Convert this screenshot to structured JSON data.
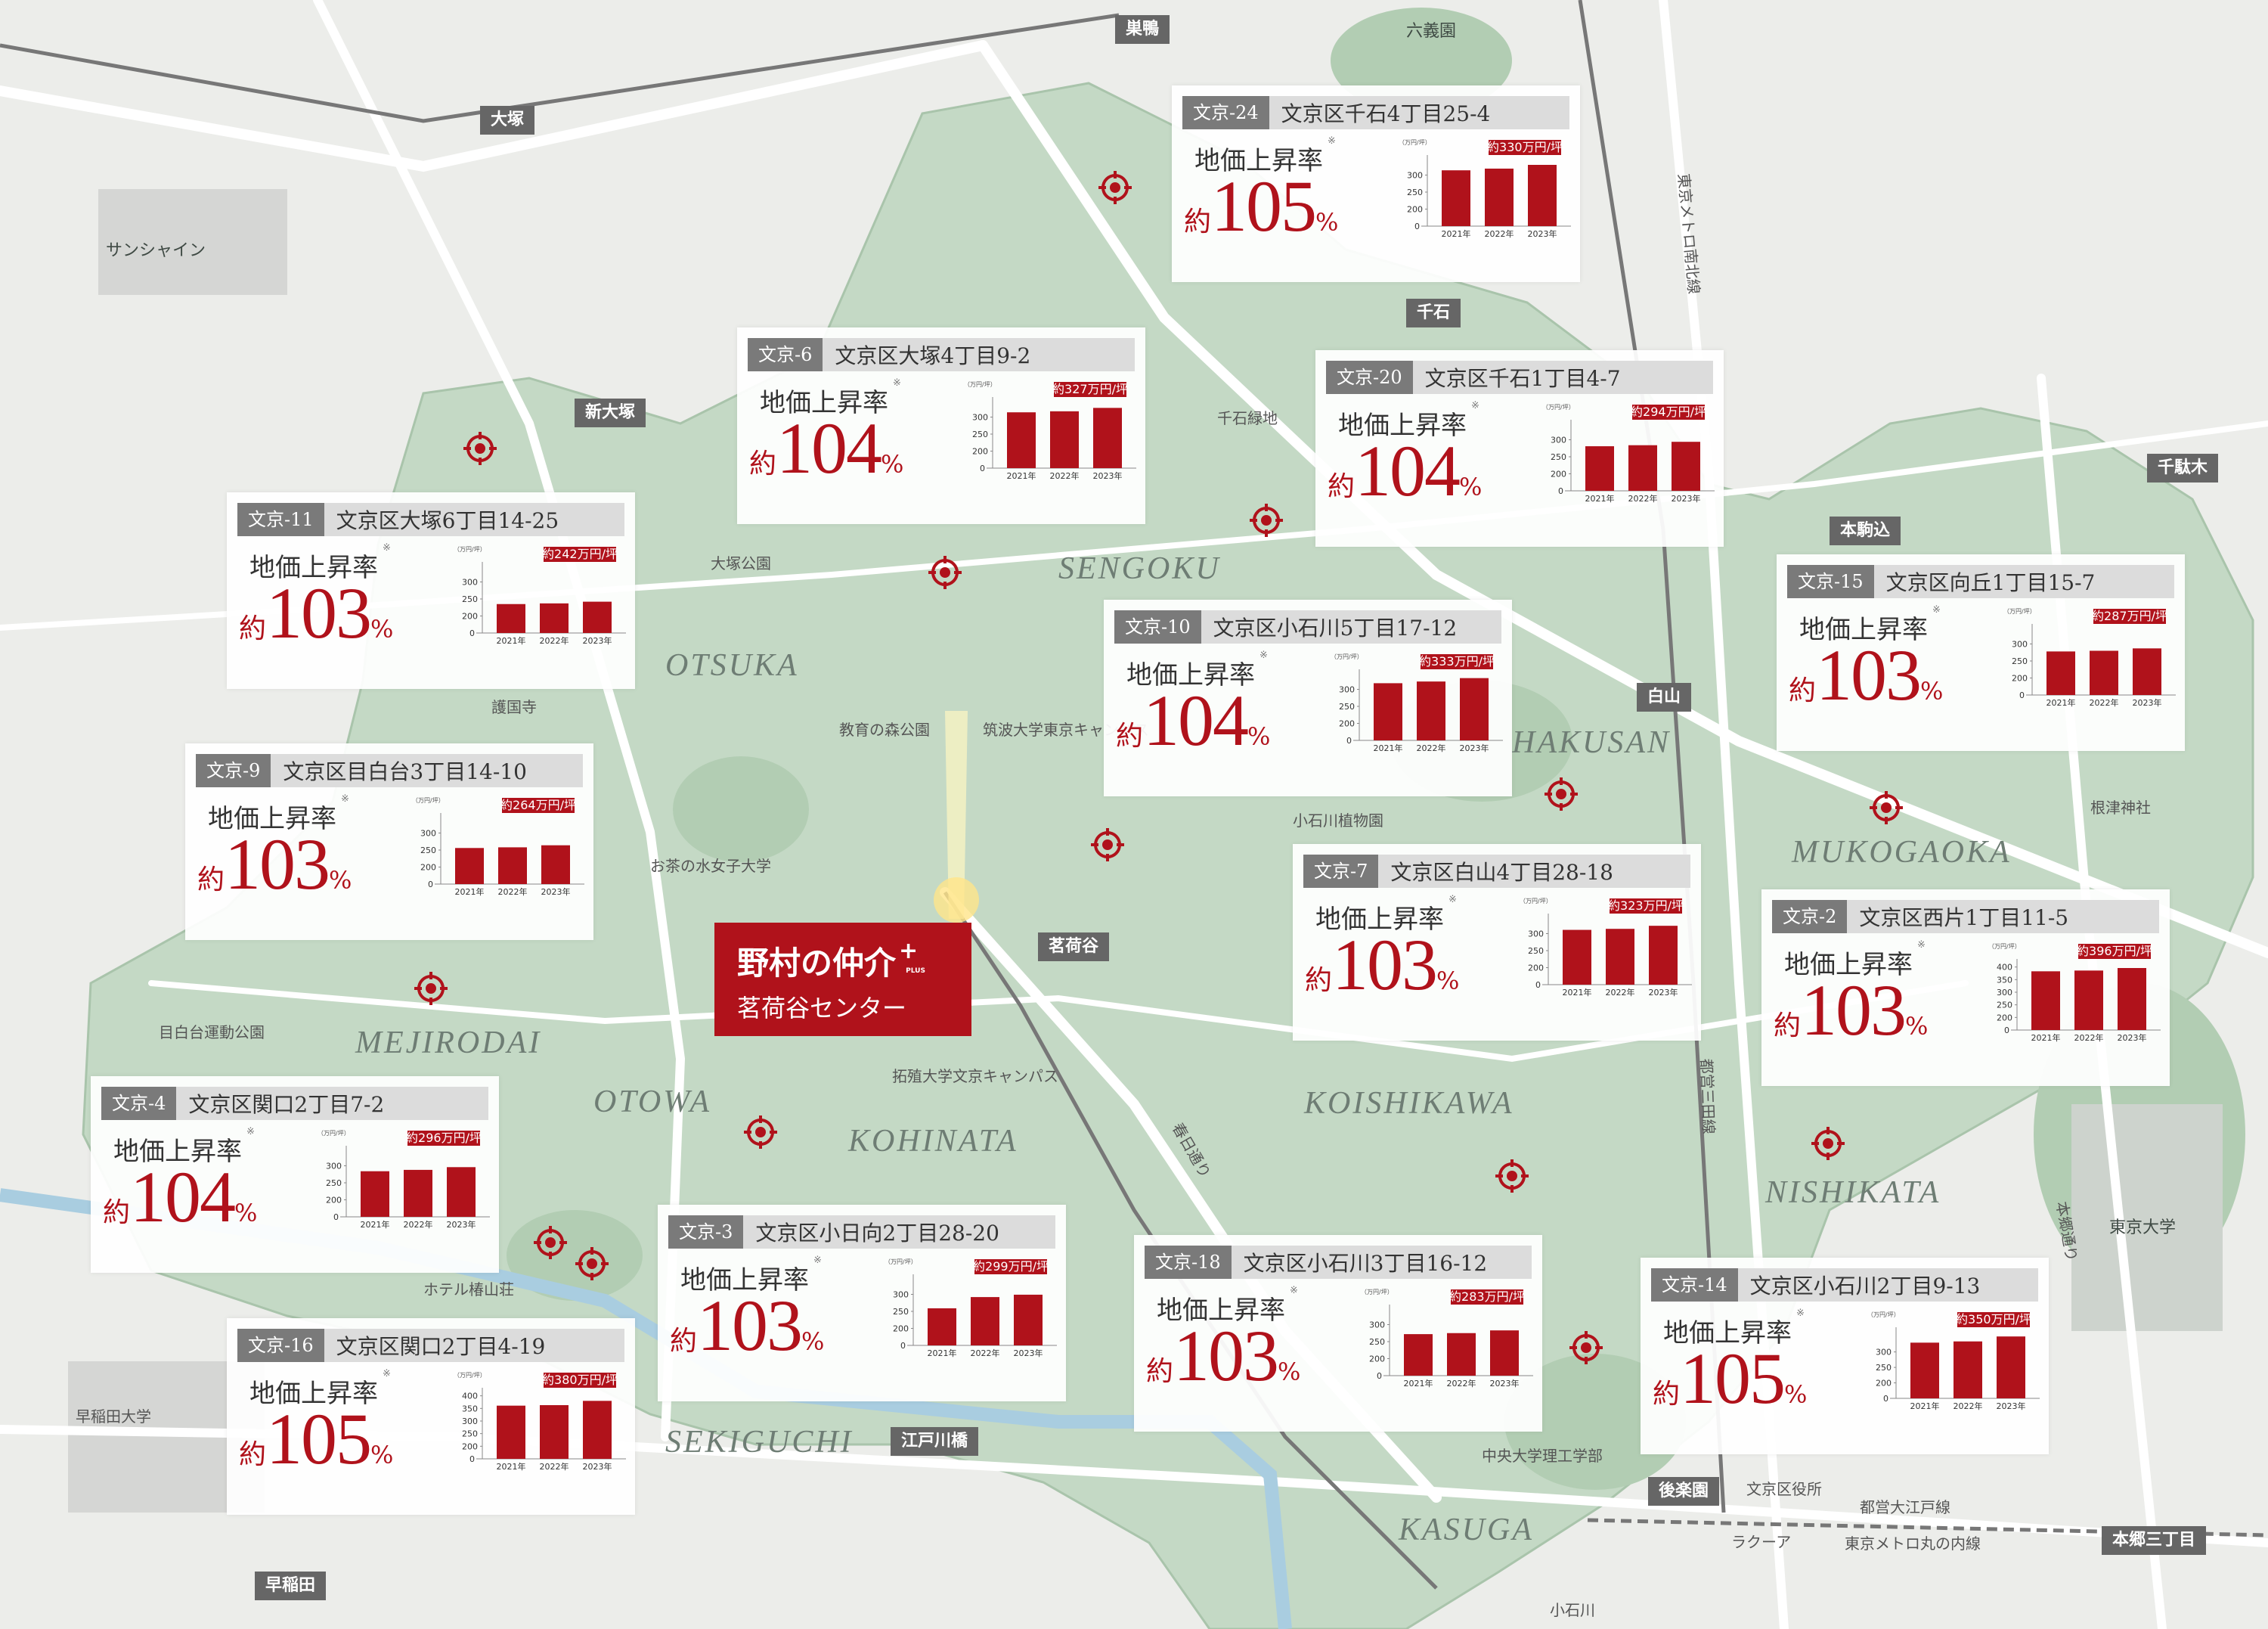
{
  "colors": {
    "accent": "#b0121b",
    "park": "#cfe0cf",
    "bunkyo_area": "#b8d2ba",
    "road": "#ffffff",
    "map_bg": "#ecedea"
  },
  "center": {
    "brand": "野村の仲介",
    "brand_mark": "+",
    "brand_sub": "PLUS",
    "name": "茗荷谷センター"
  },
  "stations": [
    {
      "id": "sugamo",
      "label": "巣鴨"
    },
    {
      "id": "otsuka",
      "label": "大塚"
    },
    {
      "id": "sengoku",
      "label": "千石"
    },
    {
      "id": "shin-otsuka",
      "label": "新大塚"
    },
    {
      "id": "sendagi",
      "label": "千駄木"
    },
    {
      "id": "hon-komagome",
      "label": "本駒込"
    },
    {
      "id": "hakusan",
      "label": "白山"
    },
    {
      "id": "myogadani",
      "label": "茗荷谷"
    },
    {
      "id": "edogawabashi",
      "label": "江戸川橋"
    },
    {
      "id": "korakuen",
      "label": "後楽園"
    },
    {
      "id": "hongo-sanchome",
      "label": "本郷三丁目"
    },
    {
      "id": "waseda",
      "label": "早稲田"
    }
  ],
  "areas": [
    "OTSUKA",
    "SENGOKU",
    "HAKUSAN",
    "MUKOGAOKA",
    "MEJIRODAI",
    "OTOWA",
    "KOHINATA",
    "KOISHIKAWA",
    "NISHIKATA",
    "SEKIGUCHI",
    "KASUGA"
  ],
  "places": [
    "六義園",
    "サンシャイン",
    "大塚公園",
    "千石緑地",
    "護国寺",
    "教育の森公園",
    "筑波大学東京キャンパス",
    "お茶の水女子大学",
    "小石川植物園",
    "根津神社",
    "目白台運動公園",
    "拓殖大学文京キャンパス",
    "ホテル椿山荘",
    "早稲田大学",
    "中央大学理工学部",
    "文京区役所",
    "ラクーア",
    "東京大学",
    "小石川",
    "春日通り",
    "本郷通り",
    "東京メトロ南北線",
    "都営三田線",
    "都営大江戸線",
    "東京メトロ丸の内線"
  ],
  "labels": {
    "rate": "地価上昇率",
    "note_mark": "※",
    "approx": "約",
    "percent": "%",
    "unit": "（万円/坪）",
    "price_prefix": "約",
    "price_suffix": "万円/坪"
  },
  "cards": [
    {
      "code": "文京-24",
      "address": "文京区千石4丁目25-4",
      "rate": "105",
      "price": "330",
      "yticks": [
        "300",
        "250",
        "200"
      ],
      "years": [
        "2021年",
        "2022年",
        "2023年"
      ],
      "chart_data": {
        "type": "bar",
        "categories": [
          "2021年",
          "2022年",
          "2023年"
        ],
        "values": [
          314,
          319,
          330
        ],
        "ylim": [
          150,
          350
        ]
      }
    },
    {
      "code": "文京-6",
      "address": "文京区大塚4丁目9-2",
      "rate": "104",
      "price": "327",
      "yticks": [
        "300",
        "250",
        "200"
      ],
      "years": [
        "2021年",
        "2022年",
        "2023年"
      ],
      "chart_data": {
        "type": "bar",
        "categories": [
          "2021年",
          "2022年",
          "2023年"
        ],
        "values": [
          314,
          317,
          327
        ],
        "ylim": [
          150,
          350
        ]
      }
    },
    {
      "code": "文京-20",
      "address": "文京区千石1丁目4-7",
      "rate": "104",
      "price": "294",
      "yticks": [
        "300",
        "250",
        "200"
      ],
      "years": [
        "2021年",
        "2022年",
        "2023年"
      ],
      "chart_data": {
        "type": "bar",
        "categories": [
          "2021年",
          "2022年",
          "2023年"
        ],
        "values": [
          281,
          284,
          294
        ],
        "ylim": [
          150,
          350
        ]
      }
    },
    {
      "code": "文京-11",
      "address": "文京区大塚6丁目14-25",
      "rate": "103",
      "price": "242",
      "yticks": [
        "300",
        "250",
        "200"
      ],
      "years": [
        "2021年",
        "2022年",
        "2023年"
      ],
      "chart_data": {
        "type": "bar",
        "categories": [
          "2021年",
          "2022年",
          "2023年"
        ],
        "values": [
          235,
          237,
          242
        ],
        "ylim": [
          150,
          350
        ]
      }
    },
    {
      "code": "文京-10",
      "address": "文京区小石川5丁目17-12",
      "rate": "104",
      "price": "333",
      "yticks": [
        "300",
        "250",
        "200"
      ],
      "years": [
        "2021年",
        "2022年",
        "2023年"
      ],
      "chart_data": {
        "type": "bar",
        "categories": [
          "2021年",
          "2022年",
          "2023年"
        ],
        "values": [
          318,
          323,
          333
        ],
        "ylim": [
          150,
          350
        ]
      }
    },
    {
      "code": "文京-15",
      "address": "文京区向丘1丁目15-7",
      "rate": "103",
      "price": "287",
      "yticks": [
        "300",
        "250",
        "200"
      ],
      "years": [
        "2021年",
        "2022年",
        "2023年"
      ],
      "chart_data": {
        "type": "bar",
        "categories": [
          "2021年",
          "2022年",
          "2023年"
        ],
        "values": [
          278,
          280,
          287
        ],
        "ylim": [
          150,
          350
        ]
      }
    },
    {
      "code": "文京-9",
      "address": "文京区目白台3丁目14-10",
      "rate": "103",
      "price": "264",
      "yticks": [
        "300",
        "250",
        "200"
      ],
      "years": [
        "2021年",
        "2022年",
        "2023年"
      ],
      "chart_data": {
        "type": "bar",
        "categories": [
          "2021年",
          "2022年",
          "2023年"
        ],
        "values": [
          256,
          258,
          264
        ],
        "ylim": [
          150,
          350
        ]
      }
    },
    {
      "code": "文京-7",
      "address": "文京区白山4丁目28-18",
      "rate": "103",
      "price": "323",
      "yticks": [
        "300",
        "250",
        "200"
      ],
      "years": [
        "2021年",
        "2022年",
        "2023年"
      ],
      "chart_data": {
        "type": "bar",
        "categories": [
          "2021年",
          "2022年",
          "2023年"
        ],
        "values": [
          311,
          314,
          323
        ],
        "ylim": [
          150,
          350
        ]
      }
    },
    {
      "code": "文京-2",
      "address": "文京区西片1丁目11-5",
      "rate": "103",
      "price": "396",
      "yticks": [
        "400",
        "350",
        "300",
        "250",
        "200"
      ],
      "years": [
        "2021年",
        "2022年",
        "2023年"
      ],
      "chart_data": {
        "type": "bar",
        "categories": [
          "2021年",
          "2022年",
          "2023年"
        ],
        "values": [
          383,
          386,
          396
        ],
        "ylim": [
          150,
          420
        ]
      }
    },
    {
      "code": "文京-4",
      "address": "文京区関口2丁目7-2",
      "rate": "104",
      "price": "296",
      "yticks": [
        "300",
        "250",
        "200"
      ],
      "years": [
        "2021年",
        "2022年",
        "2023年"
      ],
      "chart_data": {
        "type": "bar",
        "categories": [
          "2021年",
          "2022年",
          "2023年"
        ],
        "values": [
          284,
          288,
          296
        ],
        "ylim": [
          150,
          350
        ]
      }
    },
    {
      "code": "文京-3",
      "address": "文京区小日向2丁目28-20",
      "rate": "103",
      "price": "299",
      "yticks": [
        "300",
        "250",
        "200"
      ],
      "years": [
        "2021年",
        "2022年",
        "2023年"
      ],
      "chart_data": {
        "type": "bar",
        "categories": [
          "2021年",
          "2022年",
          "2023年"
        ],
        "values": [
          259,
          292,
          299
        ],
        "ylim": [
          150,
          350
        ]
      }
    },
    {
      "code": "文京-18",
      "address": "文京区小石川3丁目16-12",
      "rate": "103",
      "price": "283",
      "yticks": [
        "300",
        "250",
        "200"
      ],
      "years": [
        "2021年",
        "2022年",
        "2023年"
      ],
      "chart_data": {
        "type": "bar",
        "categories": [
          "2021年",
          "2022年",
          "2023年"
        ],
        "values": [
          272,
          275,
          283
        ],
        "ylim": [
          150,
          350
        ]
      }
    },
    {
      "code": "文京-14",
      "address": "文京区小石川2丁目9-13",
      "rate": "105",
      "price": "350",
      "yticks": [
        "300",
        "250",
        "200"
      ],
      "years": [
        "2021年",
        "2022年",
        "2023年"
      ],
      "chart_data": {
        "type": "bar",
        "categories": [
          "2021年",
          "2022年",
          "2023年"
        ],
        "values": [
          330,
          334,
          350
        ],
        "ylim": [
          150,
          370
        ]
      }
    },
    {
      "code": "文京-16",
      "address": "文京区関口2丁目4-19",
      "rate": "105",
      "price": "380",
      "yticks": [
        "400",
        "350",
        "300",
        "250",
        "200"
      ],
      "years": [
        "2021年",
        "2022年",
        "2023年"
      ],
      "chart_data": {
        "type": "bar",
        "categories": [
          "2021年",
          "2022年",
          "2023年"
        ],
        "values": [
          361,
          363,
          380
        ],
        "ylim": [
          150,
          420
        ]
      }
    }
  ]
}
